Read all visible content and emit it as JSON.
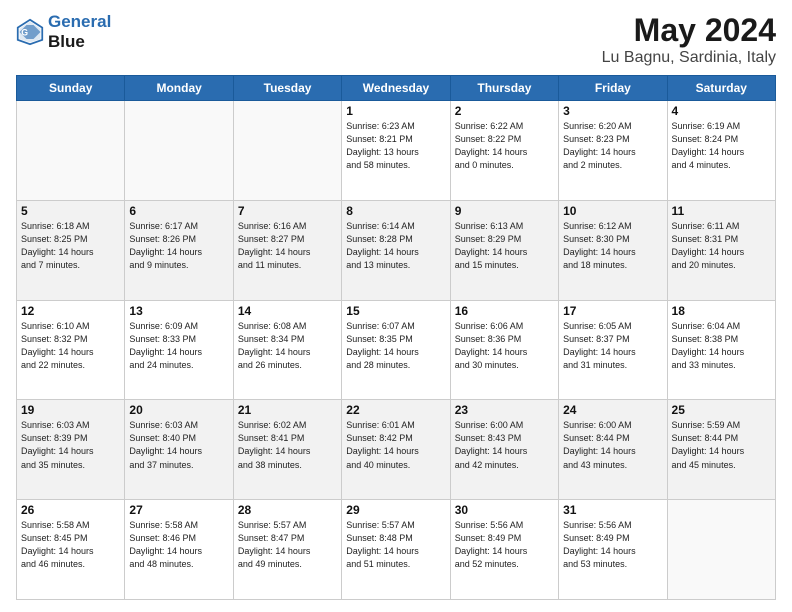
{
  "header": {
    "logo_line1": "General",
    "logo_line2": "Blue",
    "title": "May 2024",
    "location": "Lu Bagnu, Sardinia, Italy"
  },
  "days_of_week": [
    "Sunday",
    "Monday",
    "Tuesday",
    "Wednesday",
    "Thursday",
    "Friday",
    "Saturday"
  ],
  "weeks": [
    {
      "alt": false,
      "days": [
        {
          "num": "",
          "info": ""
        },
        {
          "num": "",
          "info": ""
        },
        {
          "num": "",
          "info": ""
        },
        {
          "num": "1",
          "info": "Sunrise: 6:23 AM\nSunset: 8:21 PM\nDaylight: 13 hours\nand 58 minutes."
        },
        {
          "num": "2",
          "info": "Sunrise: 6:22 AM\nSunset: 8:22 PM\nDaylight: 14 hours\nand 0 minutes."
        },
        {
          "num": "3",
          "info": "Sunrise: 6:20 AM\nSunset: 8:23 PM\nDaylight: 14 hours\nand 2 minutes."
        },
        {
          "num": "4",
          "info": "Sunrise: 6:19 AM\nSunset: 8:24 PM\nDaylight: 14 hours\nand 4 minutes."
        }
      ]
    },
    {
      "alt": true,
      "days": [
        {
          "num": "5",
          "info": "Sunrise: 6:18 AM\nSunset: 8:25 PM\nDaylight: 14 hours\nand 7 minutes."
        },
        {
          "num": "6",
          "info": "Sunrise: 6:17 AM\nSunset: 8:26 PM\nDaylight: 14 hours\nand 9 minutes."
        },
        {
          "num": "7",
          "info": "Sunrise: 6:16 AM\nSunset: 8:27 PM\nDaylight: 14 hours\nand 11 minutes."
        },
        {
          "num": "8",
          "info": "Sunrise: 6:14 AM\nSunset: 8:28 PM\nDaylight: 14 hours\nand 13 minutes."
        },
        {
          "num": "9",
          "info": "Sunrise: 6:13 AM\nSunset: 8:29 PM\nDaylight: 14 hours\nand 15 minutes."
        },
        {
          "num": "10",
          "info": "Sunrise: 6:12 AM\nSunset: 8:30 PM\nDaylight: 14 hours\nand 18 minutes."
        },
        {
          "num": "11",
          "info": "Sunrise: 6:11 AM\nSunset: 8:31 PM\nDaylight: 14 hours\nand 20 minutes."
        }
      ]
    },
    {
      "alt": false,
      "days": [
        {
          "num": "12",
          "info": "Sunrise: 6:10 AM\nSunset: 8:32 PM\nDaylight: 14 hours\nand 22 minutes."
        },
        {
          "num": "13",
          "info": "Sunrise: 6:09 AM\nSunset: 8:33 PM\nDaylight: 14 hours\nand 24 minutes."
        },
        {
          "num": "14",
          "info": "Sunrise: 6:08 AM\nSunset: 8:34 PM\nDaylight: 14 hours\nand 26 minutes."
        },
        {
          "num": "15",
          "info": "Sunrise: 6:07 AM\nSunset: 8:35 PM\nDaylight: 14 hours\nand 28 minutes."
        },
        {
          "num": "16",
          "info": "Sunrise: 6:06 AM\nSunset: 8:36 PM\nDaylight: 14 hours\nand 30 minutes."
        },
        {
          "num": "17",
          "info": "Sunrise: 6:05 AM\nSunset: 8:37 PM\nDaylight: 14 hours\nand 31 minutes."
        },
        {
          "num": "18",
          "info": "Sunrise: 6:04 AM\nSunset: 8:38 PM\nDaylight: 14 hours\nand 33 minutes."
        }
      ]
    },
    {
      "alt": true,
      "days": [
        {
          "num": "19",
          "info": "Sunrise: 6:03 AM\nSunset: 8:39 PM\nDaylight: 14 hours\nand 35 minutes."
        },
        {
          "num": "20",
          "info": "Sunrise: 6:03 AM\nSunset: 8:40 PM\nDaylight: 14 hours\nand 37 minutes."
        },
        {
          "num": "21",
          "info": "Sunrise: 6:02 AM\nSunset: 8:41 PM\nDaylight: 14 hours\nand 38 minutes."
        },
        {
          "num": "22",
          "info": "Sunrise: 6:01 AM\nSunset: 8:42 PM\nDaylight: 14 hours\nand 40 minutes."
        },
        {
          "num": "23",
          "info": "Sunrise: 6:00 AM\nSunset: 8:43 PM\nDaylight: 14 hours\nand 42 minutes."
        },
        {
          "num": "24",
          "info": "Sunrise: 6:00 AM\nSunset: 8:44 PM\nDaylight: 14 hours\nand 43 minutes."
        },
        {
          "num": "25",
          "info": "Sunrise: 5:59 AM\nSunset: 8:44 PM\nDaylight: 14 hours\nand 45 minutes."
        }
      ]
    },
    {
      "alt": false,
      "days": [
        {
          "num": "26",
          "info": "Sunrise: 5:58 AM\nSunset: 8:45 PM\nDaylight: 14 hours\nand 46 minutes."
        },
        {
          "num": "27",
          "info": "Sunrise: 5:58 AM\nSunset: 8:46 PM\nDaylight: 14 hours\nand 48 minutes."
        },
        {
          "num": "28",
          "info": "Sunrise: 5:57 AM\nSunset: 8:47 PM\nDaylight: 14 hours\nand 49 minutes."
        },
        {
          "num": "29",
          "info": "Sunrise: 5:57 AM\nSunset: 8:48 PM\nDaylight: 14 hours\nand 51 minutes."
        },
        {
          "num": "30",
          "info": "Sunrise: 5:56 AM\nSunset: 8:49 PM\nDaylight: 14 hours\nand 52 minutes."
        },
        {
          "num": "31",
          "info": "Sunrise: 5:56 AM\nSunset: 8:49 PM\nDaylight: 14 hours\nand 53 minutes."
        },
        {
          "num": "",
          "info": ""
        }
      ]
    }
  ]
}
